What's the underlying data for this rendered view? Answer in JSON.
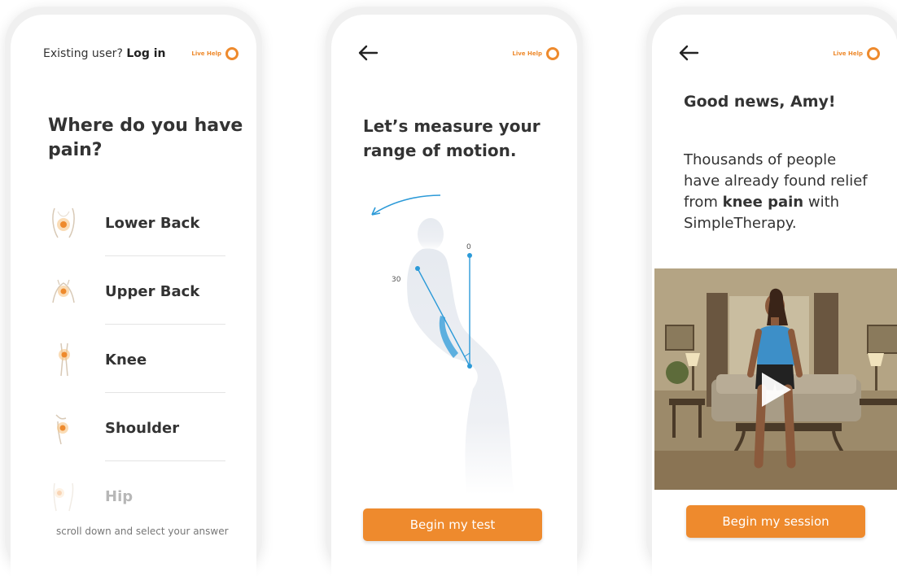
{
  "colors": {
    "accent": "#ee8a2d",
    "motion_blue": "#2c9ad8",
    "text_dark": "#333333"
  },
  "screen1": {
    "login_prompt": "Existing user?",
    "login_link": "Log in",
    "live_help": "Live Help",
    "question": "Where do you have pain?",
    "pain_areas": [
      {
        "label": "Lower Back",
        "icon": "lower-back-icon"
      },
      {
        "label": "Upper Back",
        "icon": "upper-back-icon"
      },
      {
        "label": "Knee",
        "icon": "knee-icon"
      },
      {
        "label": "Shoulder",
        "icon": "shoulder-icon"
      },
      {
        "label": "Hip",
        "icon": "hip-icon"
      }
    ],
    "scroll_hint": "scroll down and select your answer"
  },
  "screen2": {
    "back_icon": "back-arrow-icon",
    "live_help": "Live Help",
    "title": "Let’s measure your range of motion.",
    "angle_start": "0",
    "angle_end": "30",
    "button": "Begin my test"
  },
  "screen3": {
    "back_icon": "back-arrow-icon",
    "live_help": "Live Help",
    "greeting": "Good news, Amy!",
    "message_start": "Thousands of people have already found relief from",
    "message_bold": "knee pain",
    "message_end": "with SimpleTherapy.",
    "play_icon": "play-icon",
    "button": "Begin my session"
  }
}
